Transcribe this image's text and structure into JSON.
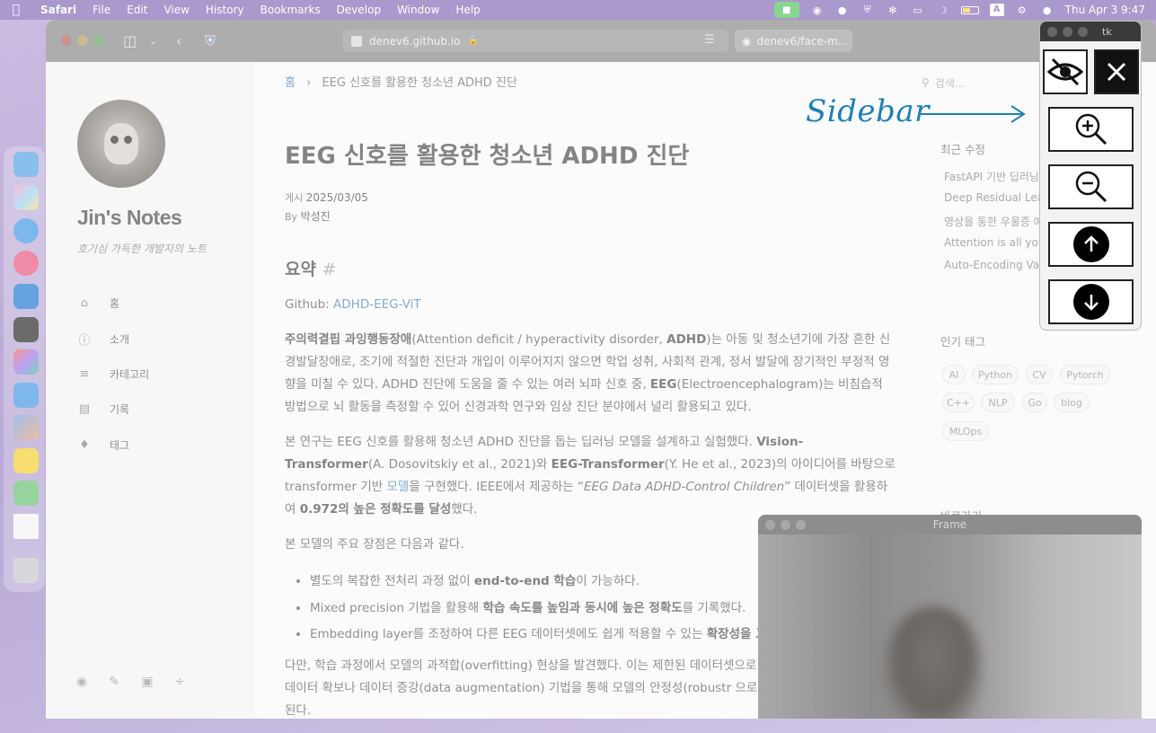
{
  "menubar": {
    "app": "Safari",
    "items": [
      "File",
      "Edit",
      "View",
      "History",
      "Bookmarks",
      "Develop",
      "Window",
      "Help"
    ],
    "clock": "Thu Apr 3  9:47",
    "input_source": "A"
  },
  "browser": {
    "url": "denev6.github.io",
    "second_tab": "denev6/face-m..."
  },
  "site": {
    "title": "Jin's Notes",
    "subtitle": "호기심 가득한 개발자의 노트",
    "nav": [
      {
        "label": "홈",
        "icon": "home-icon"
      },
      {
        "label": "소개",
        "icon": "info-icon"
      },
      {
        "label": "카테고리",
        "icon": "list-icon"
      },
      {
        "label": "기록",
        "icon": "archive-icon"
      },
      {
        "label": "태그",
        "icon": "tags-icon"
      }
    ]
  },
  "breadcrumb": {
    "home": "홈",
    "separator": "›",
    "current": "EEG 신호를 활용한 청소년 ADHD 진단"
  },
  "post": {
    "title": "EEG 신호를 활용한 청소년 ADHD 진단",
    "posted_label": "게시",
    "date": "2025/03/05",
    "by_label": "By",
    "author": "박성진",
    "section_heading": "요약",
    "section_hash": "#",
    "github_label": "Github:",
    "github_link": "ADHD-EEG-ViT",
    "p1": {
      "b1": "주의력결핍 과잉행동장애",
      "t1": "(Attention deficit / hyperactivity disorder, ",
      "b2": "ADHD",
      "t2": ")는 아동 및 청소년기에 가장 흔한 신경발달장애로, 조기에 적절한 진단과 개입이 이루어지지 않으면 학업 성취, 사회적 관계, 정서 발달에 장기적인 부정적 영향을 미칠 수 있다. ADHD 진단에 도움을 줄 수 있는 여러 뇌파 신호 중, ",
      "b3": "EEG",
      "t3": "(Electroencephalogram)는 비침습적 방법으로 뇌 활동을 측정할 수 있어 신경과학 연구와 임상 진단 분야에서 널리 활용되고 있다."
    },
    "p2": {
      "t1": "본 연구는 EEG 신호를 활용해 청소년 ADHD 진단을 돕는 딥러닝 모델을 설계하고 실험했다. ",
      "b1": "Vision-Transformer",
      "t2": "(A. Dosovitskiy et al., 2021)와 ",
      "b2": "EEG-Transformer",
      "t3": "(Y. He et al., 2023)의 아이디어를 바탕으로 transformer 기반 ",
      "link": "모델",
      "t4": "을 구현했다. IEEE에서 제공하는 “",
      "i1": "EEG Data ADHD-Control Children",
      "t5": "” 데이터셋을 활용하여 ",
      "b3": "0.972의 높은 정확도를 달성",
      "t6": "했다."
    },
    "p3": "본 모델의 주요 장점은 다음과 같다.",
    "bullets": [
      {
        "pre": "별도의 복잡한 전처리 과정 없이 ",
        "bold": "end-to-end 학습",
        "post": "이 가능하다."
      },
      {
        "pre": "Mixed precision 기법을 활용해 ",
        "bold": "학습 속도를 높임과 동시에 높은 정확도",
        "post": "를 기록했다."
      },
      {
        "pre": "Embedding layer를 조정하여 다른 EEG 데이터셋에도 쉽게 적용할 수 있는 ",
        "bold": "확장성을 고",
        "post": ""
      }
    ],
    "p4": "다만, 학습 과정에서 모델의 과적합(overfitting) 현상을 발견했다. 이는 제한된 데이터셋으로 추가 데이터 확보나 데이터 증강(data augmentation) 기법을 통해 모델의 안정성(robustr 으로 기대된다."
  },
  "right_sidebar": {
    "search_placeholder": "검색...",
    "recent_heading": "최근 수정",
    "recent": [
      "FastAPI 기반 딥러닝",
      "Deep Residual Lea",
      "영상을 통한 우울증 예",
      "Attention is all you",
      "Auto-Encoding Va"
    ],
    "tags_heading": "인기 태그",
    "tags": [
      "AI",
      "Python",
      "CV",
      "Pytorch",
      "C++",
      "NLP",
      "Go",
      "blog",
      "MLOps"
    ],
    "shortcut_heading": "바로가기"
  },
  "annotation": "Sidebar",
  "tk_window": {
    "title": "tk",
    "buttons": [
      "hide-icon",
      "close-icon",
      "zoom-in-icon",
      "zoom-out-icon",
      "arrow-up-icon",
      "arrow-down-icon"
    ]
  },
  "frame_window": {
    "title": "Frame"
  },
  "colors": {
    "link": "#5c8bb8",
    "annotation": "#1f7fb3",
    "menubar": "#8a72b9"
  }
}
